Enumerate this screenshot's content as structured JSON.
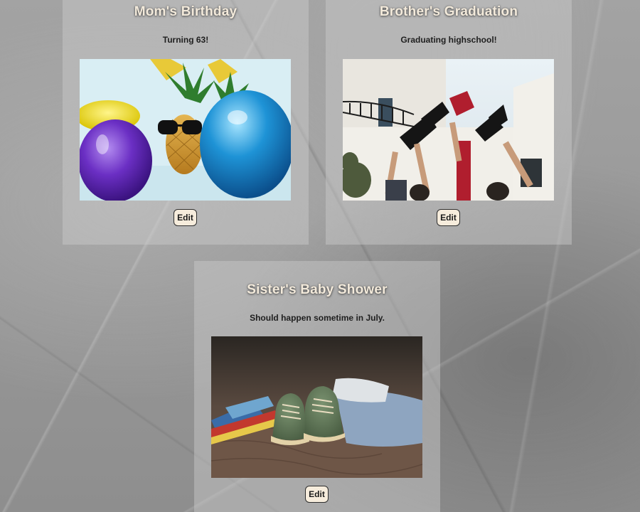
{
  "cards": [
    {
      "title": "Mom's Birthday",
      "description": "Turning 63!",
      "image": "party-pineapple-balloons-photo",
      "edit_label": "Edit"
    },
    {
      "title": "Brother's Graduation",
      "description": "Graduating highschool!",
      "image": "graduation-caps-photo",
      "edit_label": "Edit"
    },
    {
      "title": "Sister's Baby Shower",
      "description": "Should happen sometime in July.",
      "image": "baby-shoes-photo",
      "edit_label": "Edit"
    }
  ],
  "colors": {
    "card_background": "#cdcdcd",
    "title_text": "#f3eadb",
    "button_background": "#f6ecdc"
  }
}
